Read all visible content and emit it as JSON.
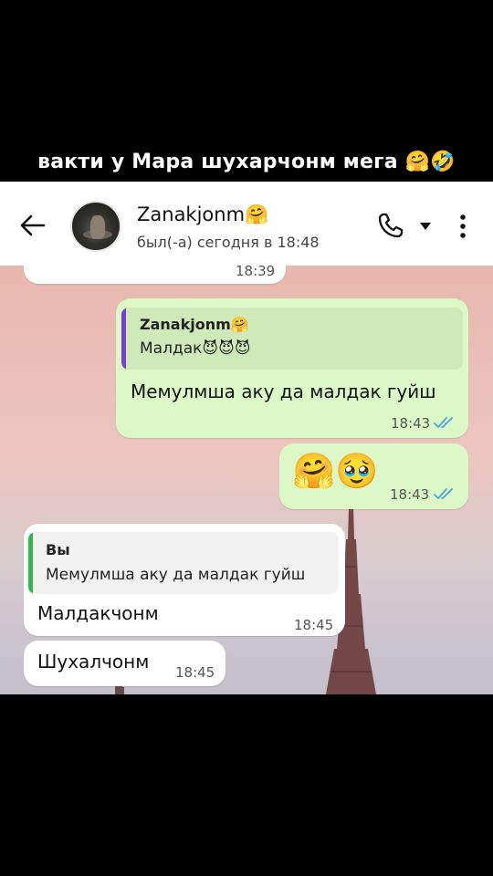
{
  "caption": {
    "text": "вакти у Мара шухарчонм мега",
    "emoji": "🤗🤣"
  },
  "header": {
    "name": "Zanakjonm",
    "name_emoji": "🤗",
    "status": "был(-а) сегодня в 18:48",
    "icons": [
      "back-arrow-icon",
      "avatar",
      "phone-icon",
      "chevron-down-icon",
      "more-vert-icon"
    ]
  },
  "messages": [
    {
      "id": "m0",
      "direction": "incoming",
      "text": "😈😈😈",
      "time": "18:39",
      "partial": true
    },
    {
      "id": "m1",
      "direction": "outgoing",
      "reply_to": {
        "name": "Zanakjonm",
        "name_emoji": "🤗",
        "text": "Малдак😈😈😈"
      },
      "text": "Мемулмша аку да малдак гуйш",
      "time": "18:43",
      "status": "read"
    },
    {
      "id": "m2",
      "direction": "outgoing",
      "text": "🤗🥹",
      "time": "18:43",
      "status": "read"
    },
    {
      "id": "m3",
      "direction": "incoming",
      "reply_to": {
        "name": "Вы",
        "text": "Мемулмша аку да малдак гуйш"
      },
      "text": "Малдакчонм",
      "time": "18:45"
    },
    {
      "id": "m4",
      "direction": "incoming",
      "text": "Шухалчонм",
      "time": "18:45"
    }
  ],
  "colors": {
    "outgoing_bubble": "#dcf8c6",
    "incoming_bubble": "#ffffff",
    "read_ticks": "#4fa3e0",
    "quote_bar_outgoing": "#7b3fd0",
    "quote_bar_incoming": "#2fb84b"
  }
}
